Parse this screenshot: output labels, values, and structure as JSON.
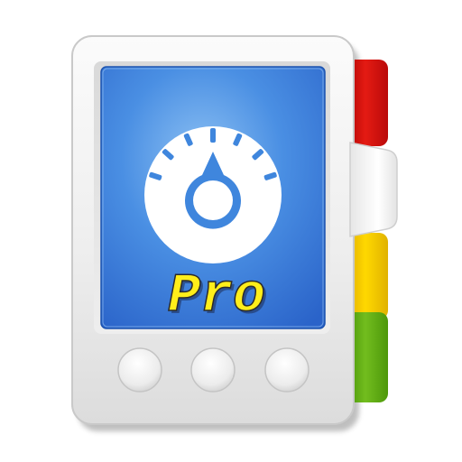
{
  "icon": {
    "name": "organizer-pro-app-icon",
    "screen_text": "Pro",
    "tabs": [
      "red-tab",
      "white-tab",
      "yellow-tab",
      "green-tab"
    ],
    "buttons": [
      "button-1",
      "button-2",
      "button-3"
    ]
  },
  "colors": {
    "background": "#ffffff",
    "body": "#f3f3f3",
    "screen_blue": "#3f86dd",
    "screen_blue_dark": "#1f5ec4",
    "dial": "#ffffff",
    "text_yellow": "#ffee1a",
    "tab_red": "#d80f0f",
    "tab_yellow": "#f3cd00",
    "tab_green": "#5ea912",
    "tab_white": "#fafafa"
  }
}
